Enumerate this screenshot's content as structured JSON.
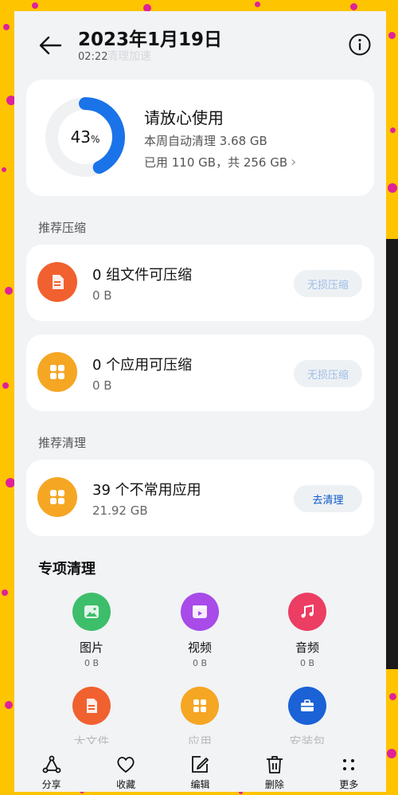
{
  "header": {
    "title": "2023年1月19日",
    "time": "02:22",
    "ghost_text": "清理加速"
  },
  "storage": {
    "percent": "43",
    "percent_sign": "%",
    "percent_value": 43,
    "status": "请放心使用",
    "weekly_clean": "本周自动清理 3.68 GB",
    "usage": "已用 110 GB，共 256 GB",
    "ring_color": "#1A73E8"
  },
  "compress": {
    "label": "推荐压缩",
    "items": [
      {
        "title": "0 组文件可压缩",
        "size": "0 B",
        "button": "无损压缩",
        "icon": "file-icon"
      },
      {
        "title": "0 个应用可压缩",
        "size": "0 B",
        "button": "无损压缩",
        "icon": "apps-grid-icon"
      }
    ]
  },
  "clean": {
    "label": "推荐清理",
    "item": {
      "title": "39 个不常用应用",
      "size": "21.92 GB",
      "button": "去清理",
      "icon": "apps-grid-icon"
    }
  },
  "special": {
    "title": "专项清理",
    "items": [
      {
        "label": "图片",
        "size": "0 B",
        "color": "#3DBE6A",
        "icon": "picture-icon"
      },
      {
        "label": "视频",
        "size": "0 B",
        "color": "#A84BE8",
        "icon": "video-icon"
      },
      {
        "label": "音频",
        "size": "0 B",
        "color": "#EC3D62",
        "icon": "music-icon"
      },
      {
        "label": "大文件",
        "size": "",
        "color": "#F0612F",
        "icon": "file-icon"
      },
      {
        "label": "应用",
        "size": "",
        "color": "#F5A623",
        "icon": "apps-grid-icon"
      },
      {
        "label": "安装包",
        "size": "",
        "color": "#1A62D6",
        "icon": "toolbox-icon"
      }
    ]
  },
  "toolbar": {
    "share": "分享",
    "favorite": "收藏",
    "edit": "编辑",
    "delete": "删除",
    "more": "更多"
  }
}
